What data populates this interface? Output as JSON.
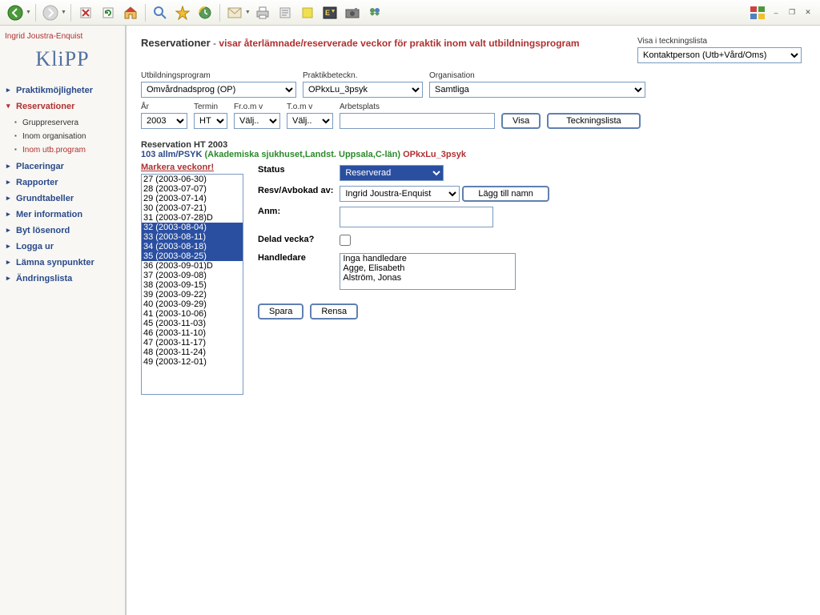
{
  "window": {
    "user": "Ingrid Joustra-Enquist",
    "logo": "KliPP"
  },
  "nav": {
    "items": [
      "Praktikmöjligheter",
      "Reservationer",
      "Placeringar",
      "Rapporter",
      "Grundtabeller",
      "Mer information",
      "Byt lösenord",
      "Logga ur",
      "Lämna synpunkter",
      "Ändringslista"
    ],
    "sub": [
      "Gruppreservera",
      "Inom organisation",
      "Inom utb.program"
    ]
  },
  "header": {
    "title": "Reservationer",
    "subtitle": "visar återlämnade/reserverade veckor för praktik inom valt utbildningsprogram",
    "visa_label": "Visa i teckningslista",
    "visa_value": "Kontaktperson (Utb+Vård/Oms)"
  },
  "filters": {
    "utbprog_label": "Utbildningsprogram",
    "utbprog": "Omvårdnadsprog (OP)",
    "prakt_label": "Praktikbeteckn.",
    "prakt": "OPkxLu_3psyk",
    "org_label": "Organisation",
    "org": "Samtliga",
    "ar_label": "År",
    "ar": "2003",
    "termin_label": "Termin",
    "termin": "HT",
    "from_label": "Fr.o.m v",
    "from": "Välj..",
    "tom_label": "T.o.m v",
    "tom": "Välj..",
    "arbets_label": "Arbetsplats",
    "arbets": "",
    "btn_visa": "Visa",
    "btn_teck": "Teckningslista"
  },
  "res": {
    "line1a": "Reservation ",
    "line1b": "HT 2003",
    "line2a": "103 allm/PSYK",
    "line2b": "(Akademiska sjukhuset,Landst. Uppsala,C-län)",
    "line2c": "OPkxLu_3psyk"
  },
  "weeks": {
    "label": "Markera veckonr!",
    "items": [
      {
        "t": "27 (2003-06-30)",
        "s": false
      },
      {
        "t": "28 (2003-07-07)",
        "s": false
      },
      {
        "t": "29 (2003-07-14)",
        "s": false
      },
      {
        "t": "30 (2003-07-21)",
        "s": false
      },
      {
        "t": "31 (2003-07-28)D",
        "s": false
      },
      {
        "t": "32 (2003-08-04)",
        "s": true
      },
      {
        "t": "33 (2003-08-11)",
        "s": true
      },
      {
        "t": "34 (2003-08-18)",
        "s": true
      },
      {
        "t": "35 (2003-08-25)",
        "s": true
      },
      {
        "t": "36 (2003-09-01)D",
        "s": false
      },
      {
        "t": "37 (2003-09-08)",
        "s": false
      },
      {
        "t": "38 (2003-09-15)",
        "s": false
      },
      {
        "t": "39 (2003-09-22)",
        "s": false
      },
      {
        "t": "40 (2003-09-29)",
        "s": false
      },
      {
        "t": "41 (2003-10-06)",
        "s": false
      },
      {
        "t": "45 (2003-11-03)",
        "s": false
      },
      {
        "t": "46 (2003-11-10)",
        "s": false
      },
      {
        "t": "47 (2003-11-17)",
        "s": false
      },
      {
        "t": "48 (2003-11-24)",
        "s": false
      },
      {
        "t": "49 (2003-12-01)",
        "s": false
      }
    ]
  },
  "form": {
    "status_label": "Status",
    "status": "Reserverad",
    "resv_label": "Resv/Avbokad av:",
    "resv": "Ingrid Joustra-Enquist",
    "btn_lagg": "Lägg till namn",
    "anm_label": "Anm:",
    "anm": "",
    "delad_label": "Delad vecka?",
    "handl_label": "Handledare",
    "handl_items": [
      "Inga handledare",
      "Agge, Elisabeth",
      "Alström, Jonas"
    ],
    "btn_spara": "Spara",
    "btn_rensa": "Rensa"
  }
}
